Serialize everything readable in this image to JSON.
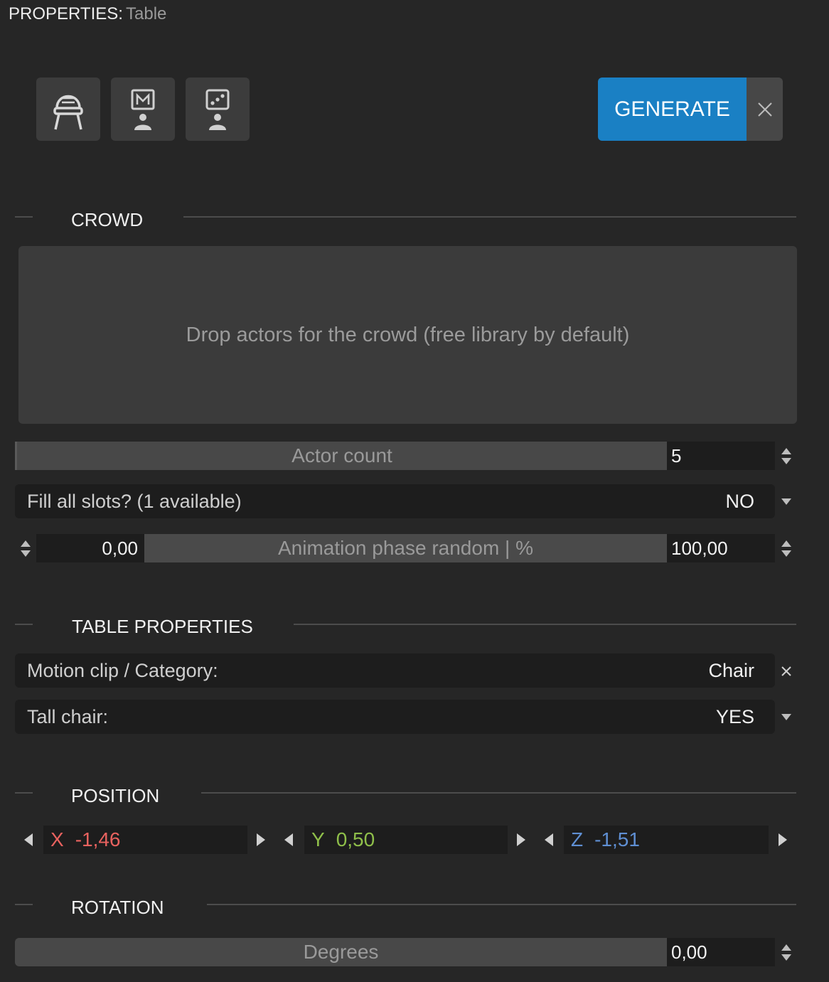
{
  "header": {
    "label": "PROPERTIES:",
    "value": "Table"
  },
  "modes": [
    {
      "icon": "chair-icon"
    },
    {
      "icon": "motion-actor-icon"
    },
    {
      "icon": "random-actor-icon"
    }
  ],
  "generate": {
    "label": "GENERATE"
  },
  "sections": {
    "crowd": "CROWD",
    "table_properties": "TABLE PROPERTIES",
    "position": "POSITION",
    "rotation": "ROTATION"
  },
  "crowd": {
    "dropzone_text": "Drop actors for the crowd (free library by default)",
    "actor_count": {
      "label": "Actor count",
      "value": "5"
    },
    "fill_slots": {
      "label": "Fill all slots? (1 available)",
      "value": "NO"
    },
    "phase": {
      "label": "Animation phase random | %",
      "min": "0,00",
      "max": "100,00"
    }
  },
  "table_properties": {
    "motion_clip": {
      "label": "Motion clip / Category:",
      "value": "Chair"
    },
    "tall_chair": {
      "label": "Tall chair:",
      "value": "YES"
    }
  },
  "position": {
    "x": {
      "axis": "X",
      "value": "-1,46",
      "color": "#e8625f"
    },
    "y": {
      "axis": "Y",
      "value": "0,50",
      "color": "#8fbf4a"
    },
    "z": {
      "axis": "Z",
      "value": "-1,51",
      "color": "#5f8fd3"
    }
  },
  "rotation": {
    "label": "Degrees",
    "value": "0,00"
  }
}
